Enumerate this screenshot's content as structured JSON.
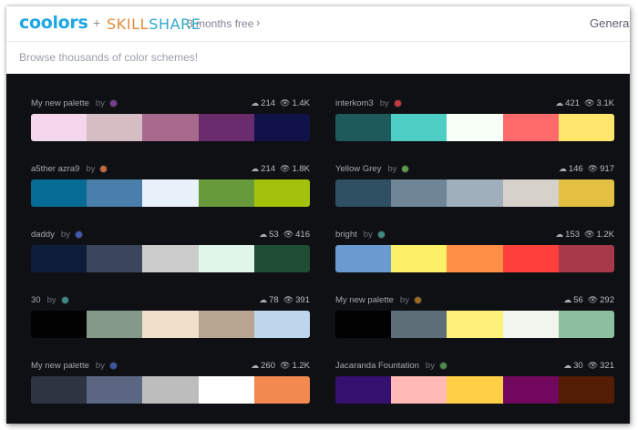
{
  "header": {
    "logo": "coolors",
    "plus": "+",
    "partner_skill": "SKILL",
    "partner_share": "SHARE",
    "promo": "3 months free",
    "promo_chevron": "›",
    "generate": "Generate"
  },
  "search": {
    "placeholder": "Browse thousands of color schemes!"
  },
  "palettes": [
    {
      "name": "My new palette",
      "by": "by",
      "avatar": "#7a3e8f",
      "likes": "214",
      "views": "1.4K",
      "colors": [
        "#f4d7ec",
        "#d6bcc3",
        "#a86a8c",
        "#692d6e",
        "#12124a"
      ]
    },
    {
      "name": "interkom3",
      "by": "by",
      "avatar": "#c8383d",
      "likes": "421",
      "views": "3.1K",
      "colors": [
        "#1e5a5c",
        "#4ecdc4",
        "#f7fff7",
        "#ff6b6b",
        "#ffe66d"
      ]
    },
    {
      "name": "a5ther azra9",
      "by": "by",
      "avatar": "#c76b3a",
      "likes": "214",
      "views": "1.8K",
      "colors": [
        "#066b95",
        "#4a7fab",
        "#e9f1fa",
        "#679a3a",
        "#a4c10b"
      ]
    },
    {
      "name": "Yellow Grey",
      "by": "by",
      "avatar": "#5b9c49",
      "likes": "146",
      "views": "917",
      "colors": [
        "#2f4f63",
        "#708595",
        "#9fafbb",
        "#d6d1ca",
        "#e3bf42"
      ]
    },
    {
      "name": "daddy",
      "by": "by",
      "avatar": "#3e5bb3",
      "likes": "53",
      "views": "416",
      "colors": [
        "#0e1c3c",
        "#3b465c",
        "#cbcbcb",
        "#dff6e9",
        "#1f4d33"
      ]
    },
    {
      "name": "bright",
      "by": "by",
      "avatar": "#3f8a80",
      "likes": "153",
      "views": "1.2K",
      "colors": [
        "#6a9bd0",
        "#fff167",
        "#ff8e46",
        "#ff3f3a",
        "#a7394a"
      ]
    },
    {
      "name": "30",
      "by": "by",
      "avatar": "#3a8a86",
      "likes": "78",
      "views": "391",
      "colors": [
        "#020202",
        "#85998a",
        "#efdfcb",
        "#b8a693",
        "#bed6eb"
      ]
    },
    {
      "name": "My new palette",
      "by": "by",
      "avatar": "#9c6b1c",
      "likes": "56",
      "views": "292",
      "colors": [
        "#010101",
        "#5d6e79",
        "#fff07a",
        "#f1f5ee",
        "#8bbf9e"
      ]
    },
    {
      "name": "My new palette",
      "by": "by",
      "avatar": "#3d55a6",
      "likes": "260",
      "views": "1.2K",
      "colors": [
        "#2f3442",
        "#5a6682",
        "#bdbdbd",
        "#ffffff",
        "#f2894f"
      ]
    },
    {
      "name": "Jacaranda Fountation",
      "by": "by",
      "avatar": "#4e8a48",
      "likes": "30",
      "views": "321",
      "colors": [
        "#35106e",
        "#ffbab6",
        "#ffd045",
        "#71085e",
        "#521d04"
      ]
    }
  ],
  "icons": {
    "likes": "cloud-upload-icon",
    "views": "eye-icon"
  }
}
